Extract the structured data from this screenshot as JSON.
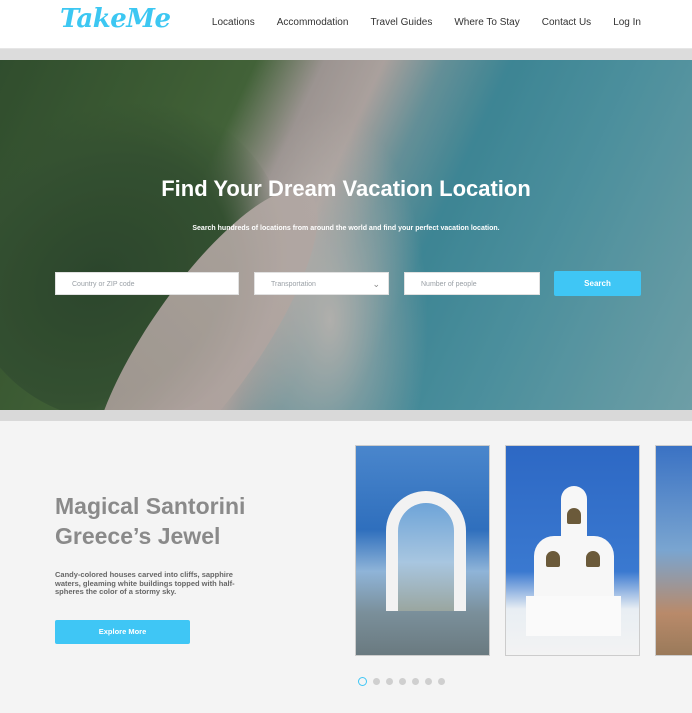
{
  "brand": {
    "name": "TakeMe",
    "accent": "#3fc6f5"
  },
  "nav": {
    "items": [
      "Locations",
      "Accommodation",
      "Travel Guides",
      "Where To Stay",
      "Contact Us",
      "Log In"
    ]
  },
  "hero": {
    "title": "Find Your Dream Vacation Location",
    "subtitle": "Search hundreds of locations from around the world and find your perfect vacation location.",
    "search": {
      "location_placeholder": "Country or ZIP code",
      "transport_selected": "Transportation",
      "people_placeholder": "Number of people",
      "button_label": "Search"
    }
  },
  "feature": {
    "title_line1": "Magical Santorini",
    "title_line2": "Greece’s Jewel",
    "description": "Candy-colored houses carved into cliffs, sapphire waters, gleaming white buildings topped with half-spheres the color of a stormy sky.",
    "button_label": "Explore More",
    "carousel": {
      "slide_count": 7,
      "active_index": 0
    }
  }
}
